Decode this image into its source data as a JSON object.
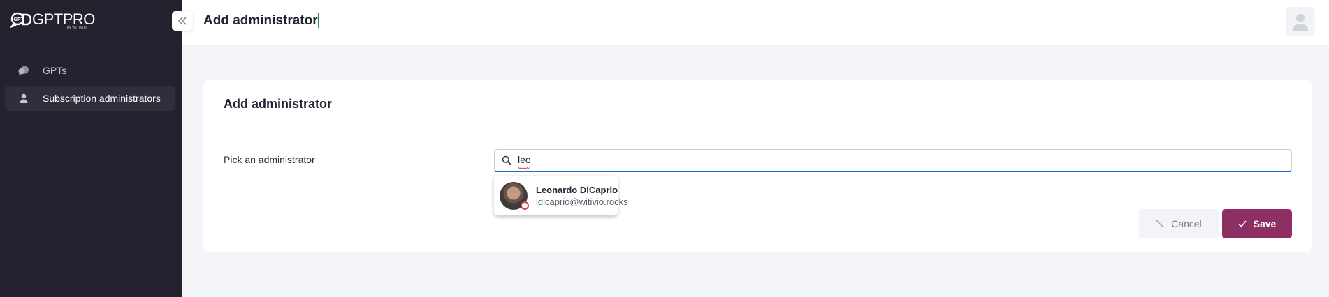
{
  "brand": {
    "name": "GPTPRO",
    "sub": "by WITIVIO"
  },
  "sidebar": {
    "items": [
      {
        "label": "GPTs",
        "icon": "chat-bubbles-icon",
        "active": false
      },
      {
        "label": "Subscription administrators",
        "icon": "person-icon",
        "active": true
      }
    ]
  },
  "header": {
    "title": "Add administrator"
  },
  "card": {
    "title": "Add administrator",
    "field_label": "Pick an administrator",
    "search_value": "leo"
  },
  "dropdown": {
    "results": [
      {
        "name": "Leonardo DiCaprio",
        "email": "ldicaprio@witivio.rocks",
        "status_color": "#d9434b"
      }
    ]
  },
  "actions": {
    "cancel_label": "Cancel",
    "save_label": "Save"
  },
  "colors": {
    "sidebar_bg": "#24222f",
    "accent": "#8e2f63",
    "focus": "#1a6fd1"
  }
}
